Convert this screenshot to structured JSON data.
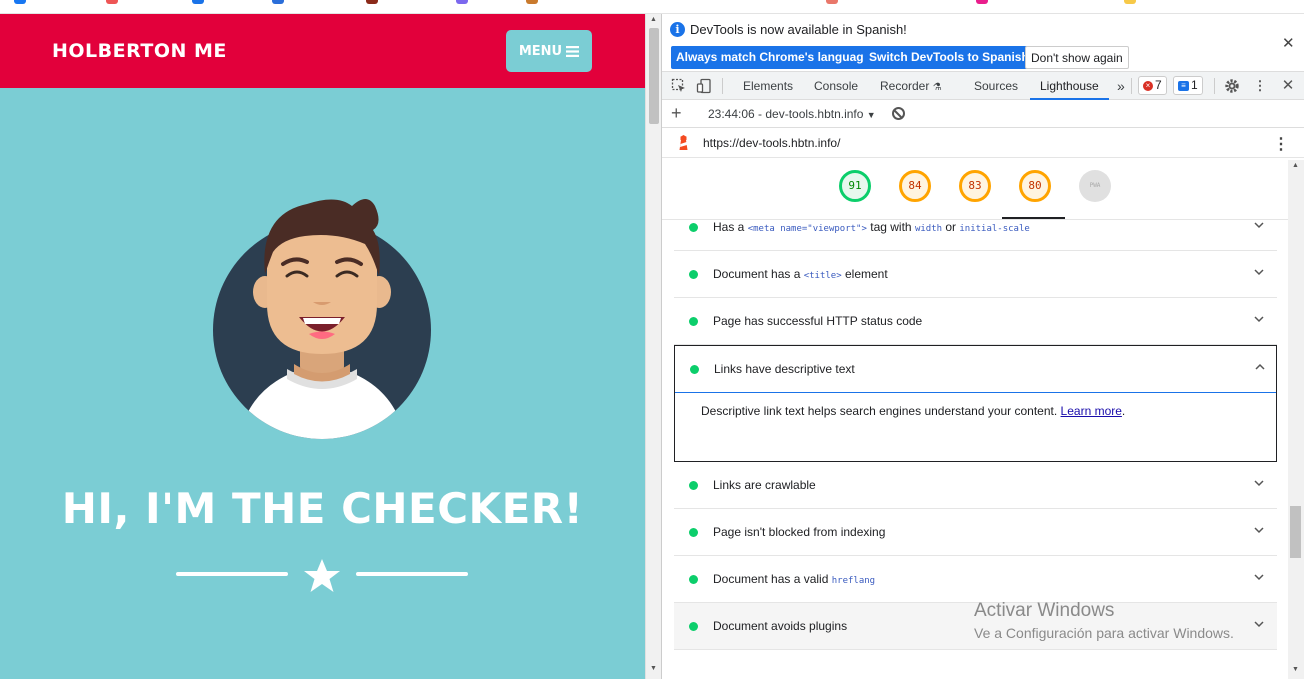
{
  "page": {
    "brand": "HOLBERTON ME",
    "menu_label": "MENU",
    "hero_title": "HI, I'M THE CHECKER!"
  },
  "devtools": {
    "infobar": {
      "message": "DevTools is now available in Spanish!",
      "btn_match": "Always match Chrome's language",
      "btn_switch": "Switch DevTools to Spanish",
      "btn_dismiss": "Don't show again"
    },
    "tabs": [
      "Elements",
      "Console",
      "Recorder",
      "Sources",
      "Lighthouse"
    ],
    "active_tab": "Lighthouse",
    "error_count": "7",
    "message_count": "1",
    "report_label": "23:44:06 - dev-tools.hbtn.info",
    "url": "https://dev-tools.hbtn.info/",
    "scores": [
      "91",
      "84",
      "83",
      "80"
    ],
    "pwa_label": "PWA",
    "audits": {
      "a0_pre": "Has a ",
      "a0_code1": "<meta name=\"viewport\">",
      "a0_mid": " tag with ",
      "a0_code2": "width",
      "a0_or": " or ",
      "a0_code3": "initial-scale",
      "a1_pre": "Document has a ",
      "a1_code": "<title>",
      "a1_post": " element",
      "a2": "Page has successful HTTP status code",
      "a3": "Links have descriptive text",
      "a3_desc": "Descriptive link text helps search engines understand your content.",
      "a3_link": "Learn more",
      "a4": "Links are crawlable",
      "a5": "Page isn't blocked from indexing",
      "a6_pre": "Document has a valid ",
      "a6_code": "hreflang",
      "a7": "Document avoids plugins"
    },
    "colors": {
      "pass": "#0cce6b",
      "average": "#ffa400",
      "accent": "#1a73e8"
    }
  },
  "watermark": {
    "line1": "Activar Windows",
    "line2": "Ve a Configuración para activar Windows."
  }
}
